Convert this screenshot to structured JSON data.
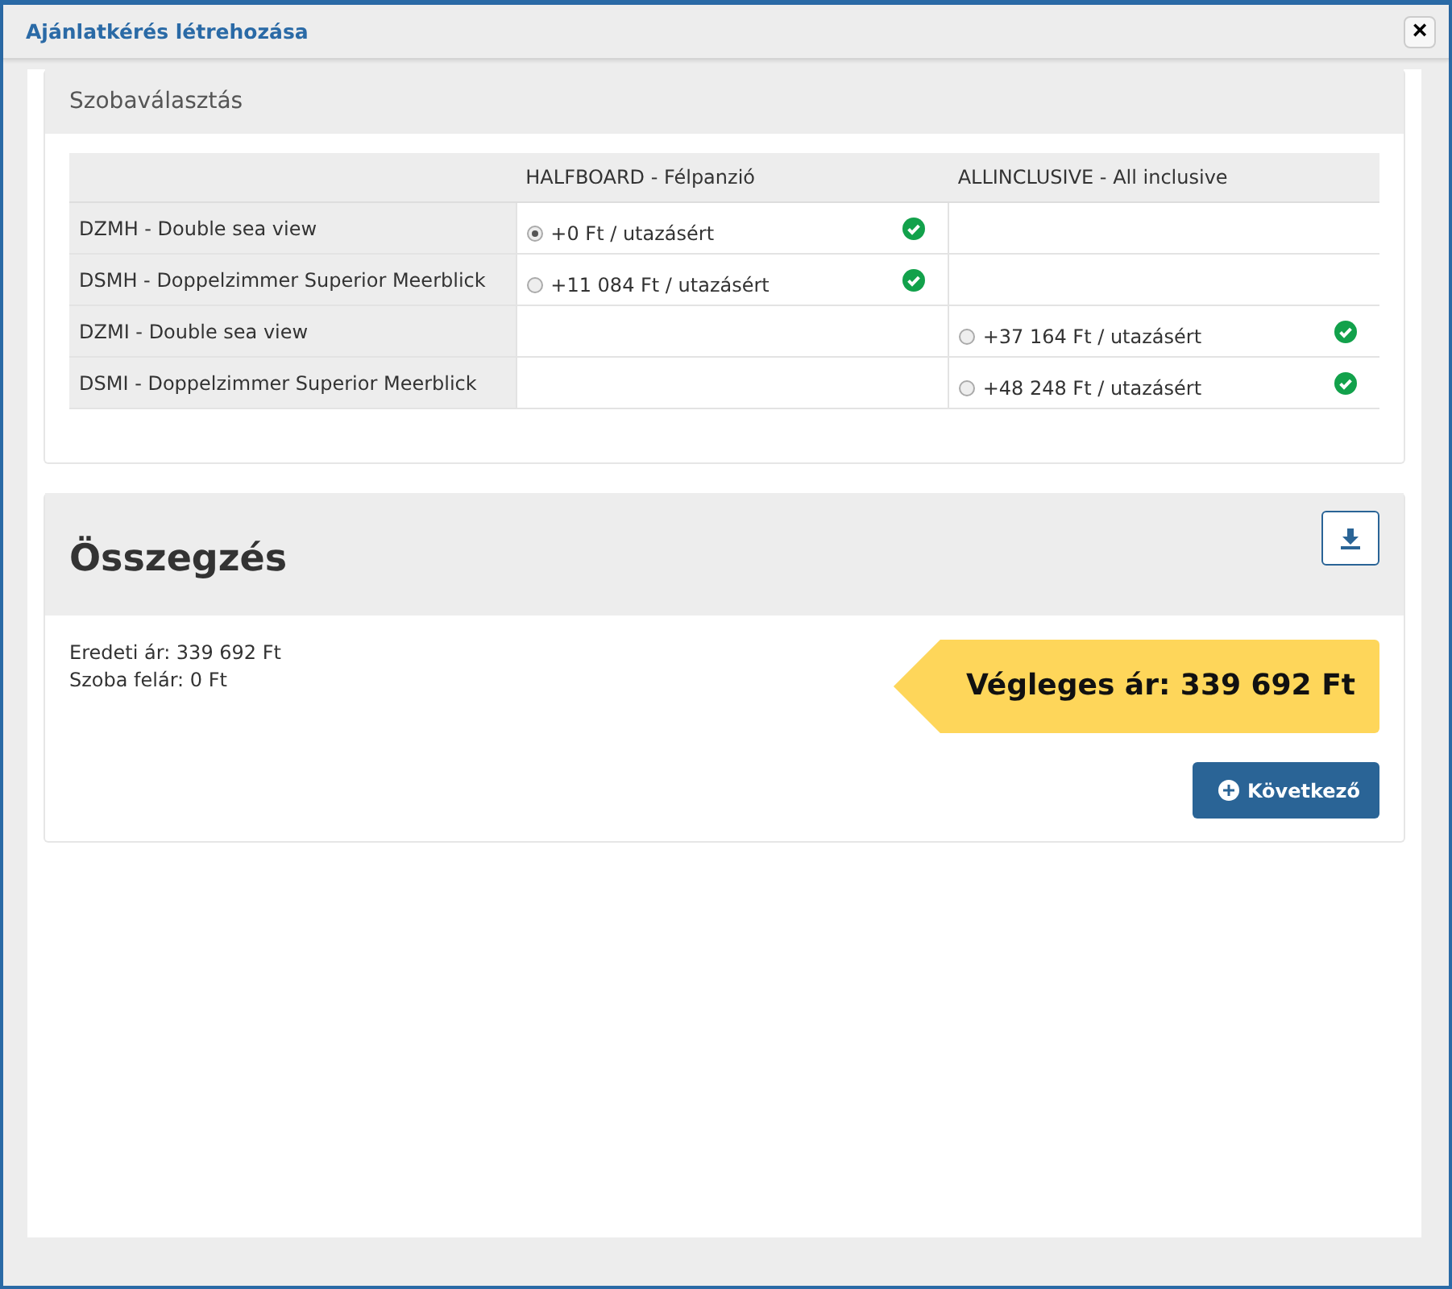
{
  "window": {
    "title": "Ajánlatkérés létrehozása",
    "close": "×"
  },
  "room_selection": {
    "title": "Szobaválasztás",
    "columns": [
      "HALFBOARD - Félpanzió",
      "ALLINCLUSIVE - All inclusive"
    ],
    "rows": [
      {
        "name": "DZMH - Double sea view",
        "cells": [
          {
            "kind": "option",
            "price": "+0 Ft / utazásért",
            "selected": true
          },
          {
            "kind": "empty"
          }
        ]
      },
      {
        "name": "DSMH - Doppelzimmer Superior Meerblick",
        "cells": [
          {
            "kind": "option",
            "price": "+11 084 Ft / utazásért",
            "selected": false
          },
          {
            "kind": "empty"
          }
        ]
      },
      {
        "name": "DZMI - Double sea view",
        "cells": [
          {
            "kind": "empty"
          },
          {
            "kind": "option",
            "price": "+37 164 Ft / utazásért",
            "selected": false
          }
        ]
      },
      {
        "name": "DSMI - Doppelzimmer Superior Meerblick",
        "cells": [
          {
            "kind": "empty"
          },
          {
            "kind": "option",
            "price": "+48 248 Ft / utazásért",
            "selected": false
          }
        ]
      }
    ]
  },
  "summary": {
    "title": "Összegzés",
    "lines": [
      "Eredeti ár: 339 692 Ft",
      "Szoba felár: 0 Ft"
    ],
    "final_price": "Végleges ár: 339 692 Ft",
    "next_button": "Következő"
  }
}
